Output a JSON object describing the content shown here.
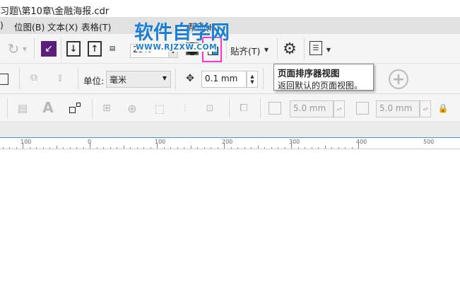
{
  "title": "习题\\第10章\\金融海报.cdr",
  "menu": [
    "位图(B)",
    "文本(X)",
    "表格(T)",
    "帮助(H)"
  ],
  "menu_partial": ")",
  "watermark": {
    "main": "软件自学网",
    "url": "WWW.RJZXW.COM"
  },
  "toolbar1": {
    "zoom_value": "25%",
    "snap_label": "贴齐(T)"
  },
  "toolbar2": {
    "unit_label": "单位:",
    "unit_value": "毫米",
    "nudge_value": "0.1 mm"
  },
  "tooltip": {
    "title": "页面排序器视图",
    "description": "返回默认的页面视图。"
  },
  "toolbar3": {
    "dup_x": "5.0 mm",
    "dup_y": "5.0 mm"
  },
  "ruler": {
    "labels": [
      "100",
      "0",
      "100",
      "200",
      "300",
      "400",
      "500"
    ]
  },
  "colors": {
    "highlight": "#ff33cc",
    "accent": "#3a9ad9",
    "watermark": "#1a7fd4"
  }
}
